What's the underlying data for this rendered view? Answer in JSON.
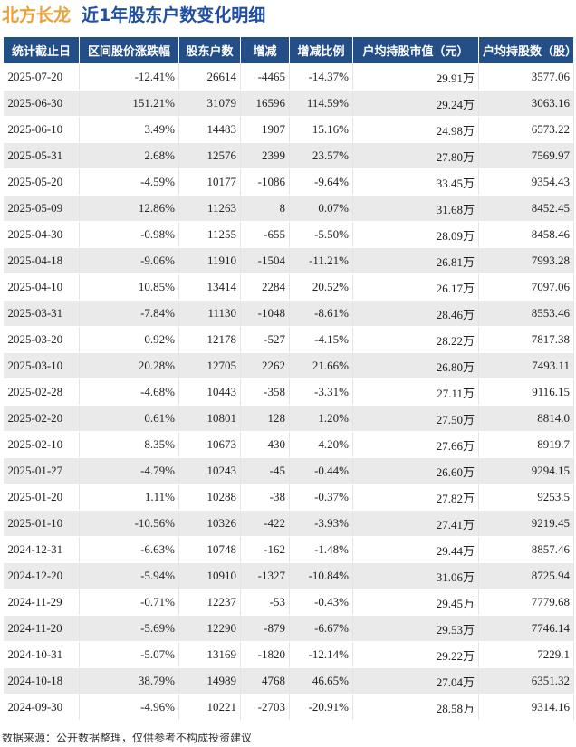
{
  "header": {
    "company": "北方长龙",
    "title": "近1年股东户数变化明细"
  },
  "columns": [
    "统计截止日",
    "区间股价涨跌幅",
    "股东户数",
    "增减",
    "增减比例",
    "户均持股市值（元）",
    "户均持股数（股）"
  ],
  "rows": [
    {
      "date": "2025-07-20",
      "change_pct": "-12.41%",
      "holders": "26614",
      "delta": "-4465",
      "delta_pct": "-14.37%",
      "avg_value": "29.91万",
      "avg_shares": "3577.06"
    },
    {
      "date": "2025-06-30",
      "change_pct": "151.21%",
      "holders": "31079",
      "delta": "16596",
      "delta_pct": "114.59%",
      "avg_value": "29.24万",
      "avg_shares": "3063.16"
    },
    {
      "date": "2025-06-10",
      "change_pct": "3.49%",
      "holders": "14483",
      "delta": "1907",
      "delta_pct": "15.16%",
      "avg_value": "24.98万",
      "avg_shares": "6573.22"
    },
    {
      "date": "2025-05-31",
      "change_pct": "2.68%",
      "holders": "12576",
      "delta": "2399",
      "delta_pct": "23.57%",
      "avg_value": "27.80万",
      "avg_shares": "7569.97"
    },
    {
      "date": "2025-05-20",
      "change_pct": "-4.59%",
      "holders": "10177",
      "delta": "-1086",
      "delta_pct": "-9.64%",
      "avg_value": "33.45万",
      "avg_shares": "9354.43"
    },
    {
      "date": "2025-05-09",
      "change_pct": "12.86%",
      "holders": "11263",
      "delta": "8",
      "delta_pct": "0.07%",
      "avg_value": "31.68万",
      "avg_shares": "8452.45"
    },
    {
      "date": "2025-04-30",
      "change_pct": "-0.98%",
      "holders": "11255",
      "delta": "-655",
      "delta_pct": "-5.50%",
      "avg_value": "28.09万",
      "avg_shares": "8458.46"
    },
    {
      "date": "2025-04-18",
      "change_pct": "-9.06%",
      "holders": "11910",
      "delta": "-1504",
      "delta_pct": "-11.21%",
      "avg_value": "26.81万",
      "avg_shares": "7993.28"
    },
    {
      "date": "2025-04-10",
      "change_pct": "10.85%",
      "holders": "13414",
      "delta": "2284",
      "delta_pct": "20.52%",
      "avg_value": "26.17万",
      "avg_shares": "7097.06"
    },
    {
      "date": "2025-03-31",
      "change_pct": "-7.84%",
      "holders": "11130",
      "delta": "-1048",
      "delta_pct": "-8.61%",
      "avg_value": "28.46万",
      "avg_shares": "8553.46"
    },
    {
      "date": "2025-03-20",
      "change_pct": "0.92%",
      "holders": "12178",
      "delta": "-527",
      "delta_pct": "-4.15%",
      "avg_value": "28.22万",
      "avg_shares": "7817.38"
    },
    {
      "date": "2025-03-10",
      "change_pct": "20.28%",
      "holders": "12705",
      "delta": "2262",
      "delta_pct": "21.66%",
      "avg_value": "26.80万",
      "avg_shares": "7493.11"
    },
    {
      "date": "2025-02-28",
      "change_pct": "-4.68%",
      "holders": "10443",
      "delta": "-358",
      "delta_pct": "-3.31%",
      "avg_value": "27.11万",
      "avg_shares": "9116.15"
    },
    {
      "date": "2025-02-20",
      "change_pct": "0.61%",
      "holders": "10801",
      "delta": "128",
      "delta_pct": "1.20%",
      "avg_value": "27.50万",
      "avg_shares": "8814.0"
    },
    {
      "date": "2025-02-10",
      "change_pct": "8.35%",
      "holders": "10673",
      "delta": "430",
      "delta_pct": "4.20%",
      "avg_value": "27.66万",
      "avg_shares": "8919.7"
    },
    {
      "date": "2025-01-27",
      "change_pct": "-4.79%",
      "holders": "10243",
      "delta": "-45",
      "delta_pct": "-0.44%",
      "avg_value": "26.60万",
      "avg_shares": "9294.15"
    },
    {
      "date": "2025-01-20",
      "change_pct": "1.11%",
      "holders": "10288",
      "delta": "-38",
      "delta_pct": "-0.37%",
      "avg_value": "27.82万",
      "avg_shares": "9253.5"
    },
    {
      "date": "2025-01-10",
      "change_pct": "-10.56%",
      "holders": "10326",
      "delta": "-422",
      "delta_pct": "-3.93%",
      "avg_value": "27.41万",
      "avg_shares": "9219.45"
    },
    {
      "date": "2024-12-31",
      "change_pct": "-6.63%",
      "holders": "10748",
      "delta": "-162",
      "delta_pct": "-1.48%",
      "avg_value": "29.44万",
      "avg_shares": "8857.46"
    },
    {
      "date": "2024-12-20",
      "change_pct": "-5.94%",
      "holders": "10910",
      "delta": "-1327",
      "delta_pct": "-10.84%",
      "avg_value": "31.06万",
      "avg_shares": "8725.94"
    },
    {
      "date": "2024-11-29",
      "change_pct": "-0.71%",
      "holders": "12237",
      "delta": "-53",
      "delta_pct": "-0.43%",
      "avg_value": "29.45万",
      "avg_shares": "7779.68"
    },
    {
      "date": "2024-11-20",
      "change_pct": "-5.69%",
      "holders": "12290",
      "delta": "-879",
      "delta_pct": "-6.67%",
      "avg_value": "29.53万",
      "avg_shares": "7746.14"
    },
    {
      "date": "2024-10-31",
      "change_pct": "-5.07%",
      "holders": "13169",
      "delta": "-1820",
      "delta_pct": "-12.14%",
      "avg_value": "29.22万",
      "avg_shares": "7229.1"
    },
    {
      "date": "2024-10-18",
      "change_pct": "38.79%",
      "holders": "14989",
      "delta": "4768",
      "delta_pct": "46.65%",
      "avg_value": "27.04万",
      "avg_shares": "6351.32"
    },
    {
      "date": "2024-09-30",
      "change_pct": "-4.96%",
      "holders": "10221",
      "delta": "-2703",
      "delta_pct": "-20.91%",
      "avg_value": "28.58万",
      "avg_shares": "9314.16"
    }
  ],
  "footer": {
    "source": "数据来源：公开数据整理，仅供参考不构成投资建议"
  },
  "colors": {
    "header_bg": "#244e86",
    "positive": "#e0221a",
    "negative": "#1f9a2b",
    "title_company": "#e8a33a",
    "title_main": "#1f4fa3"
  }
}
